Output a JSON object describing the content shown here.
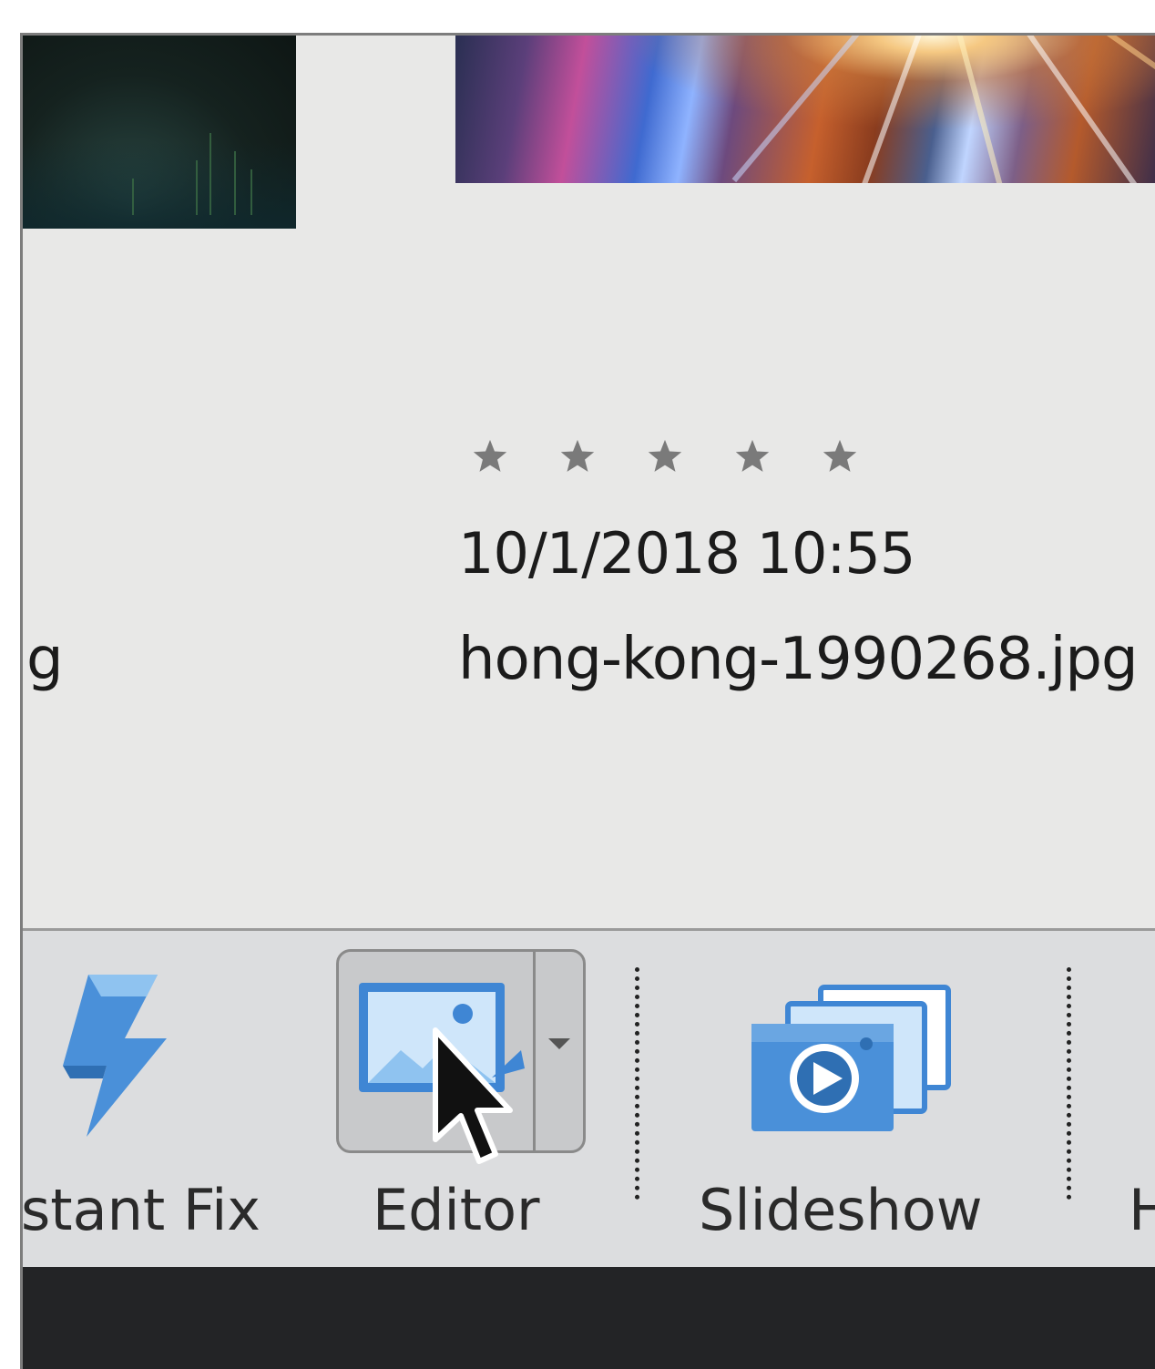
{
  "photo": {
    "rating_stars": 5,
    "rating_value": 0,
    "datetime": "10/1/2018 10:55",
    "filename": "hong-kong-1990268.jpg",
    "left_filename_fragment": "g"
  },
  "toolbar": {
    "instant_fix_label": "stant Fix",
    "editor_label": "Editor",
    "slideshow_label": "Slideshow",
    "next_label_fragment": "H"
  },
  "colors": {
    "icon_blue": "#4a90d9",
    "icon_light_blue": "#8fc3f0",
    "star_gray": "#7a7a7a",
    "footer_dark": "#232426"
  },
  "icons": {
    "instant_fix": "lightning-bolt-icon",
    "editor": "photo-editor-icon",
    "slideshow": "slideshow-icon",
    "dropdown": "chevron-down-icon",
    "cursor": "mouse-pointer-icon"
  }
}
